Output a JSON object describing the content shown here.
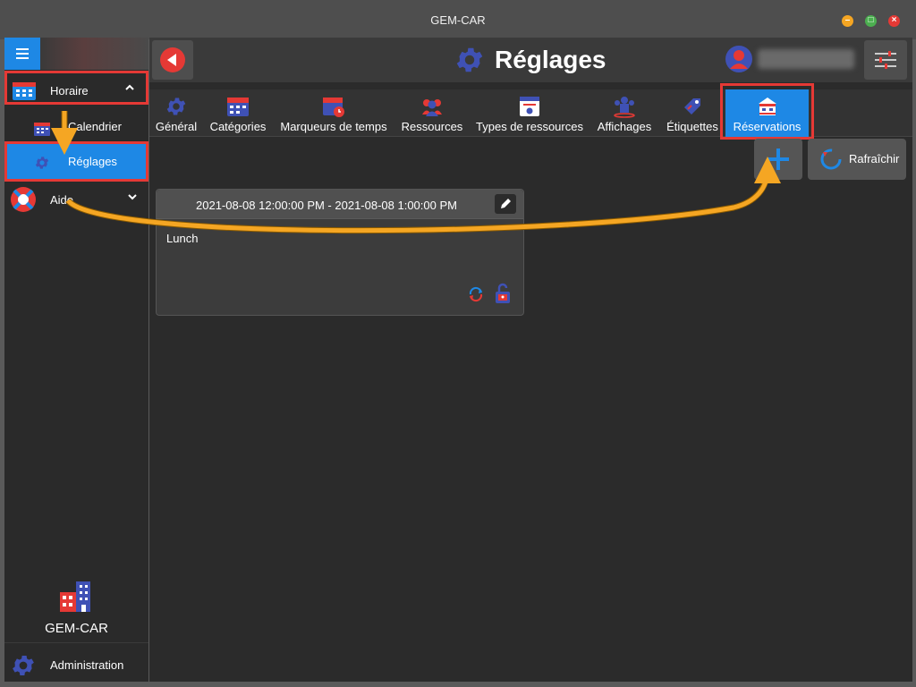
{
  "window": {
    "title": "GEM-CAR"
  },
  "window_controls": {
    "minimize": "–",
    "maximize": "□",
    "close": "×"
  },
  "sidebar": {
    "items": [
      {
        "label": "Horaire",
        "icon": "calendar-grid-icon",
        "expanded": true
      },
      {
        "label": "Calendrier",
        "icon": "calendar-icon"
      },
      {
        "label": "Réglages",
        "icon": "gear-icon",
        "active": true
      },
      {
        "label": "Aide",
        "icon": "lifebuoy-icon",
        "expanded": false
      }
    ],
    "brand": "GEM-CAR",
    "admin_label": "Administration"
  },
  "header": {
    "title": "Réglages",
    "title_icon": "gear-icon"
  },
  "tabs": [
    {
      "label": "Général",
      "icon": "gear-icon"
    },
    {
      "label": "Catégories",
      "icon": "calendar-grid-icon"
    },
    {
      "label": "Marqueurs de temps",
      "icon": "calendar-clock-icon"
    },
    {
      "label": "Ressources",
      "icon": "people-icon"
    },
    {
      "label": "Types de ressources",
      "icon": "id-card-icon"
    },
    {
      "label": "Affichages",
      "icon": "group-icon"
    },
    {
      "label": "Étiquettes",
      "icon": "tag-icon"
    },
    {
      "label": "Réservations",
      "icon": "booth-icon",
      "active": true
    }
  ],
  "toolbar": {
    "refresh_label": "Rafraîchir"
  },
  "reservation": {
    "time_range": "2021-08-08 12:00:00 PM - 2021-08-08 1:00:00 PM",
    "description": "Lunch"
  },
  "colors": {
    "accent": "#1e88e5",
    "highlight": "#e53935",
    "arrow": "#f5a623"
  }
}
